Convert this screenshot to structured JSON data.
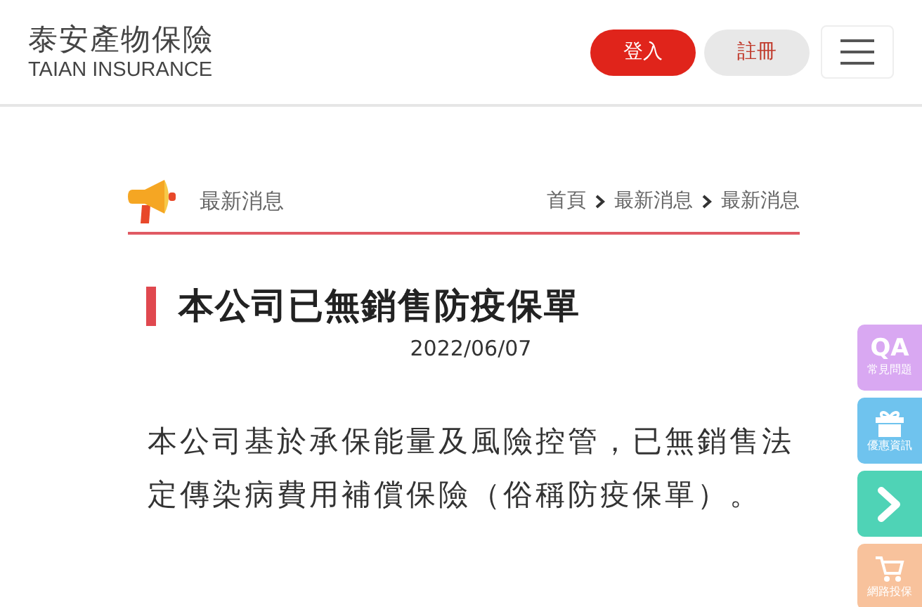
{
  "header": {
    "logo_title": "泰安產物保險",
    "logo_subtitle": "TAIAN INSURANCE",
    "buttons": [
      {
        "label": "登入",
        "kind": "primary"
      },
      {
        "label": "註冊",
        "kind": "secondary"
      }
    ]
  },
  "section": {
    "title": "最新消息",
    "breadcrumb": [
      "首頁",
      "最新消息",
      "最新消息"
    ]
  },
  "article": {
    "title": "本公司已無銷售防疫保單",
    "date": "2022/06/07",
    "body": "本公司基於承保能量及風險控管，已無銷售法定傳染病費用補償保險（俗稱防疫保單）。"
  },
  "side_tabs": [
    {
      "kind": "qa",
      "icon_text": "QA",
      "label": "常見問題",
      "color": "#d9a8f2"
    },
    {
      "kind": "gift",
      "label": "優惠資訊",
      "color": "#6fc3ee"
    },
    {
      "kind": "arrow",
      "color": "#4fd3b6"
    },
    {
      "kind": "cart",
      "label": "網路投保",
      "color": "#f8c29c"
    }
  ]
}
